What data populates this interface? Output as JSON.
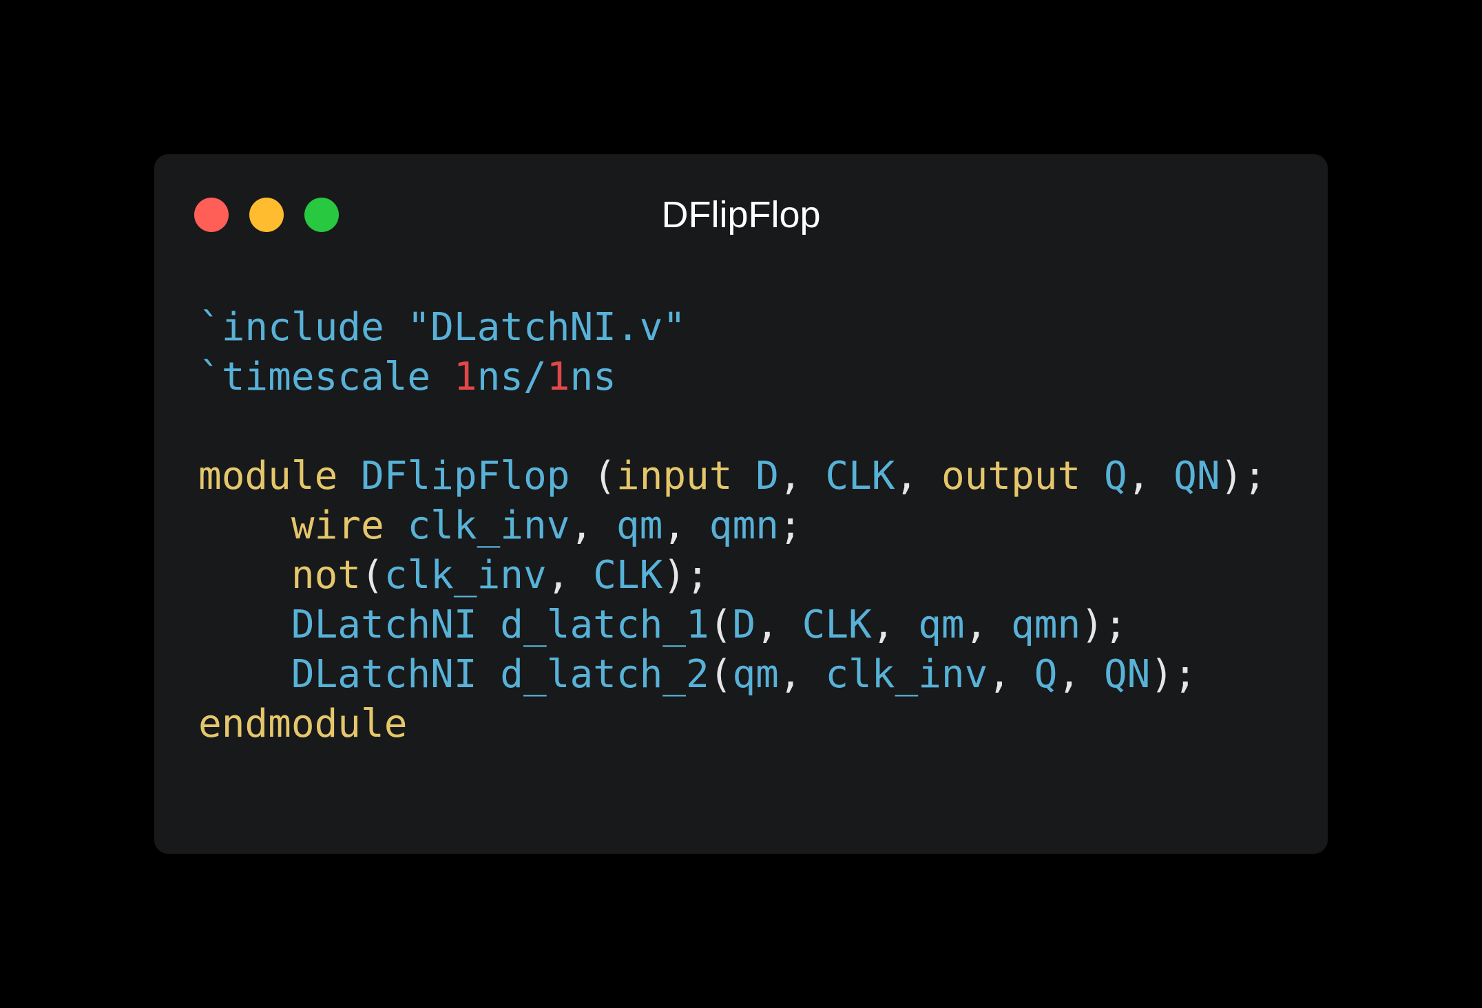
{
  "window": {
    "title": "DFlipFlop",
    "background": "#18191b",
    "traffic_lights": {
      "close_color": "#ff5f57",
      "minimize_color": "#febc2e",
      "zoom_color": "#28c840"
    }
  },
  "syntax_colors": {
    "keyword": "#e5c76b",
    "identifier": "#58b2d8",
    "number": "#e0484a",
    "punctuation": "#e6e6e6"
  },
  "code": {
    "lines": [
      [
        {
          "t": "`include \"DLatchNI.v\"",
          "k": "id"
        }
      ],
      [
        {
          "t": "`timescale ",
          "k": "id"
        },
        {
          "t": "1",
          "k": "num"
        },
        {
          "t": "ns/",
          "k": "id"
        },
        {
          "t": "1",
          "k": "num"
        },
        {
          "t": "ns",
          "k": "id"
        }
      ],
      [],
      [
        {
          "t": "module",
          "k": "kw"
        },
        {
          "t": " ",
          "k": "pun"
        },
        {
          "t": "DFlipFlop",
          "k": "id"
        },
        {
          "t": " (",
          "k": "pun"
        },
        {
          "t": "input",
          "k": "kw"
        },
        {
          "t": " ",
          "k": "pun"
        },
        {
          "t": "D",
          "k": "id"
        },
        {
          "t": ", ",
          "k": "pun"
        },
        {
          "t": "CLK",
          "k": "id"
        },
        {
          "t": ", ",
          "k": "pun"
        },
        {
          "t": "output",
          "k": "kw"
        },
        {
          "t": " ",
          "k": "pun"
        },
        {
          "t": "Q",
          "k": "id"
        },
        {
          "t": ", ",
          "k": "pun"
        },
        {
          "t": "QN",
          "k": "id"
        },
        {
          "t": ");",
          "k": "pun"
        }
      ],
      [
        {
          "t": "    ",
          "k": "pun"
        },
        {
          "t": "wire",
          "k": "kw"
        },
        {
          "t": " ",
          "k": "pun"
        },
        {
          "t": "clk_inv",
          "k": "id"
        },
        {
          "t": ", ",
          "k": "pun"
        },
        {
          "t": "qm",
          "k": "id"
        },
        {
          "t": ", ",
          "k": "pun"
        },
        {
          "t": "qmn",
          "k": "id"
        },
        {
          "t": ";",
          "k": "pun"
        }
      ],
      [
        {
          "t": "    ",
          "k": "pun"
        },
        {
          "t": "not",
          "k": "kw"
        },
        {
          "t": "(",
          "k": "pun"
        },
        {
          "t": "clk_inv",
          "k": "id"
        },
        {
          "t": ", ",
          "k": "pun"
        },
        {
          "t": "CLK",
          "k": "id"
        },
        {
          "t": ");",
          "k": "pun"
        }
      ],
      [
        {
          "t": "    ",
          "k": "pun"
        },
        {
          "t": "DLatchNI",
          "k": "id"
        },
        {
          "t": " ",
          "k": "pun"
        },
        {
          "t": "d_latch_1",
          "k": "id"
        },
        {
          "t": "(",
          "k": "pun"
        },
        {
          "t": "D",
          "k": "id"
        },
        {
          "t": ", ",
          "k": "pun"
        },
        {
          "t": "CLK",
          "k": "id"
        },
        {
          "t": ", ",
          "k": "pun"
        },
        {
          "t": "qm",
          "k": "id"
        },
        {
          "t": ", ",
          "k": "pun"
        },
        {
          "t": "qmn",
          "k": "id"
        },
        {
          "t": ");",
          "k": "pun"
        }
      ],
      [
        {
          "t": "    ",
          "k": "pun"
        },
        {
          "t": "DLatchNI",
          "k": "id"
        },
        {
          "t": " ",
          "k": "pun"
        },
        {
          "t": "d_latch_2",
          "k": "id"
        },
        {
          "t": "(",
          "k": "pun"
        },
        {
          "t": "qm",
          "k": "id"
        },
        {
          "t": ", ",
          "k": "pun"
        },
        {
          "t": "clk_inv",
          "k": "id"
        },
        {
          "t": ", ",
          "k": "pun"
        },
        {
          "t": "Q",
          "k": "id"
        },
        {
          "t": ", ",
          "k": "pun"
        },
        {
          "t": "QN",
          "k": "id"
        },
        {
          "t": ");",
          "k": "pun"
        }
      ],
      [
        {
          "t": "endmodule",
          "k": "kw"
        }
      ]
    ]
  }
}
